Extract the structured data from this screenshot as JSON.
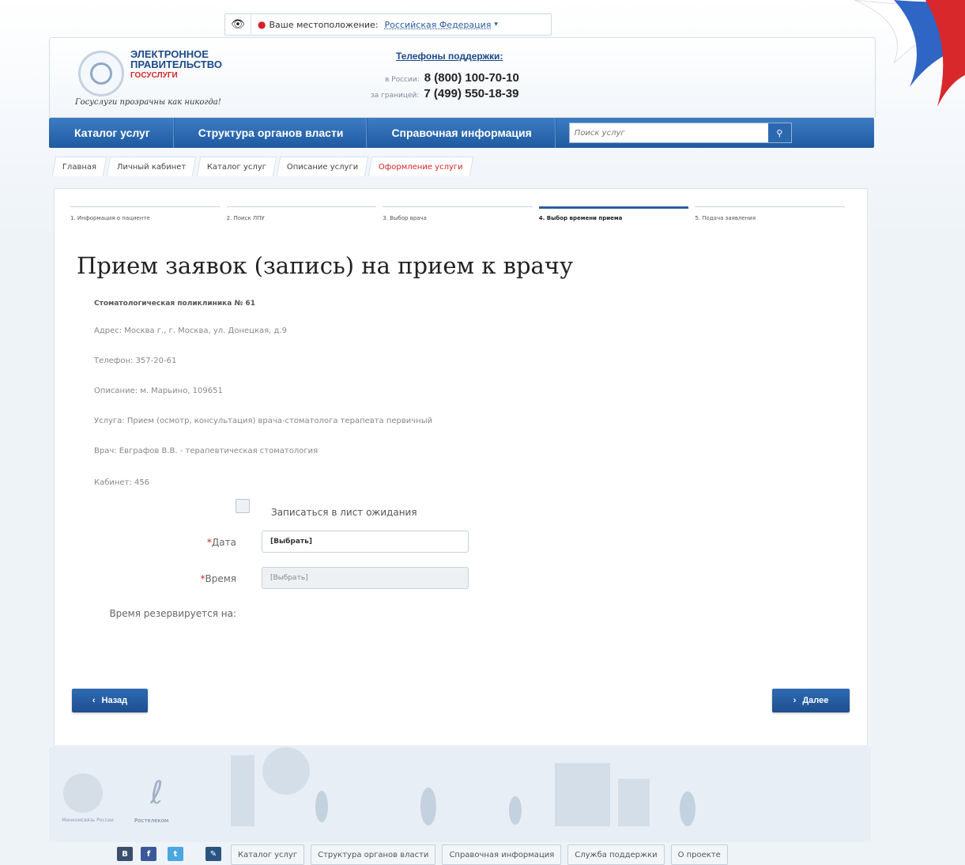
{
  "location": {
    "label": "Ваше местоположение:",
    "value": "Российская Федерация"
  },
  "logo": {
    "line1": "ЭЛЕКТРОННОЕ",
    "line2": "ПРАВИТЕЛЬСТВО",
    "line3": "ГОСУСЛУГИ",
    "slogan": "Госуслуги прозрачны как никогда!"
  },
  "support": {
    "title": "Телефоны поддержки:",
    "russia_label": "в России:",
    "russia_phone": "8 (800) 100-70-10",
    "abroad_label": "за границей:",
    "abroad_phone": "7 (499) 550-18-39"
  },
  "nav": {
    "items": [
      "Каталог услуг",
      "Структура органов власти",
      "Справочная информация"
    ],
    "search_placeholder": "Поиск услуг"
  },
  "breadcrumbs": [
    "Главная",
    "Личный кабинет",
    "Каталог услуг",
    "Описание услуги",
    "Оформление услуги"
  ],
  "steps": [
    "1. Информация о пациенте",
    "2. Поиск ЛПУ",
    "3. Выбор врача",
    "4. Выбор времени приема",
    "5. Подача заявления"
  ],
  "page": {
    "title": "Прием заявок (запись) на прием к врачу",
    "clinic": "Стоматологическая поликлиника № 61",
    "address": "Адрес: Москва г., г. Москва, ул. Донецкая, д.9",
    "phone": "Телефон: 357-20-61",
    "description": "Описание: м. Марьино, 109651",
    "service": "Услуга: Прием (осмотр, консультация) врача-стоматолога терапевта первичный",
    "doctor": "Врач: Евграфов В.В. - терапевтическая стоматология",
    "cabinet": "Кабинет: 456"
  },
  "form": {
    "waitlist_label": "Записаться в лист ожидания",
    "date_label": "Дата",
    "date_value": "[Выбрать]",
    "time_label": "Время",
    "time_value": "[Выбрать]",
    "reserve_label": "Время резервируется на:"
  },
  "buttons": {
    "back": "Назад",
    "next": "Далее"
  },
  "footer": {
    "logo1_caption": "Минкомсвязь России",
    "logo2_caption": "Ростелеком",
    "links": [
      "Каталог услуг",
      "Структура органов власти",
      "Справочная информация",
      "Служба поддержки",
      "О проекте"
    ],
    "social": [
      {
        "icon": "odnoklassniki-icon",
        "color": "#3b4f6b"
      },
      {
        "icon": "facebook-icon",
        "color": "#3b5998"
      },
      {
        "icon": "twitter-icon",
        "color": "#4aa7e0"
      },
      {
        "icon": "livejournal-icon",
        "color": "#2a5580"
      }
    ]
  },
  "colors": {
    "accent": "#1f5aa0",
    "red": "#d2242a"
  }
}
